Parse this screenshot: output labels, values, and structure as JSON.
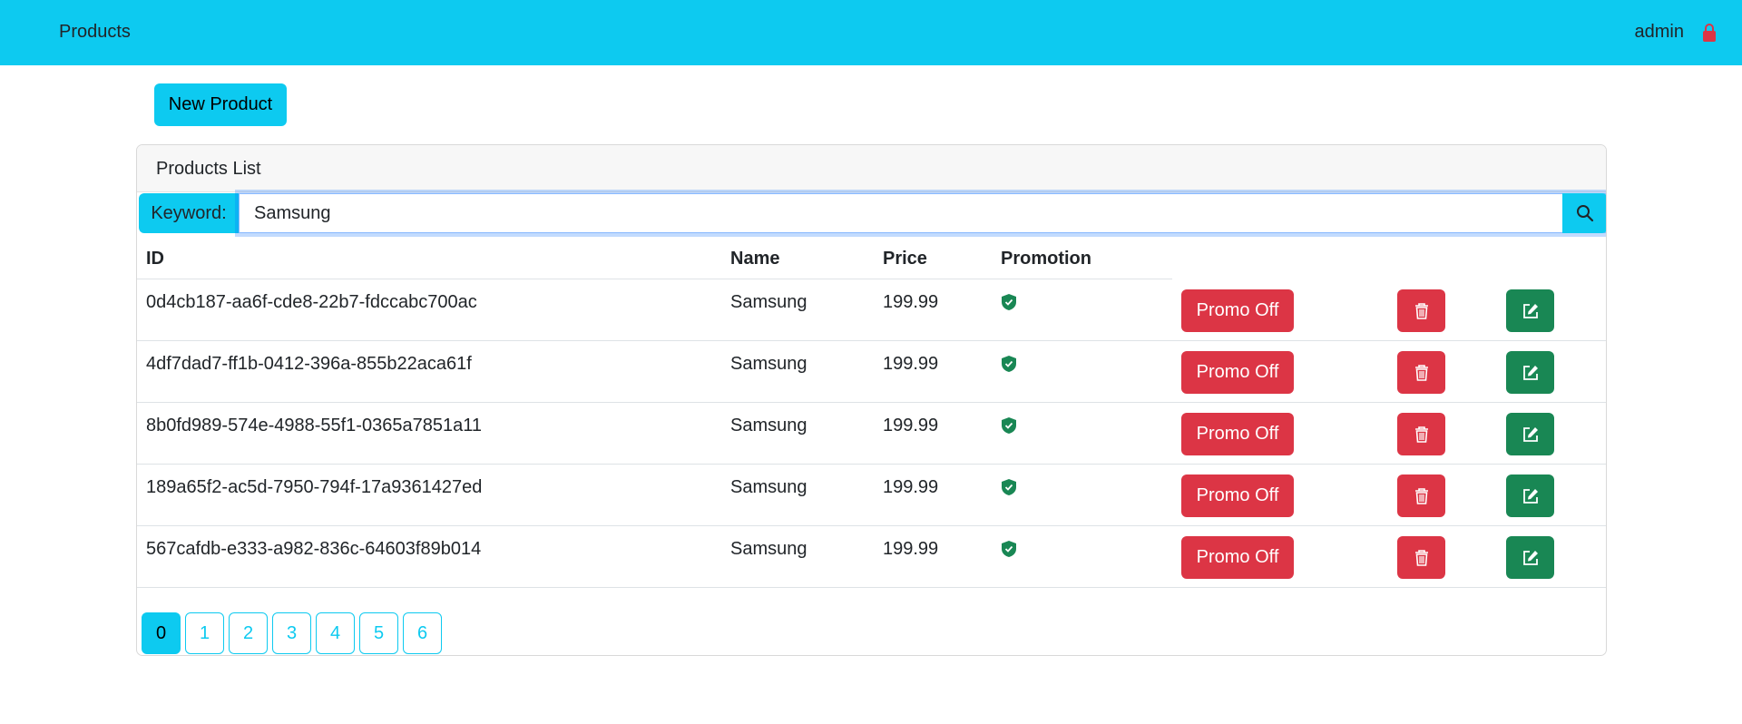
{
  "navbar": {
    "brand": "Products",
    "user": "admin",
    "logout_icon": "lock-icon",
    "background": "#0dcaf0"
  },
  "actions": {
    "new_product_label": "New Product"
  },
  "card": {
    "title": "Products List"
  },
  "search": {
    "label": "Keyword:",
    "value": "Samsung",
    "button_icon": "search-icon"
  },
  "table": {
    "headers": {
      "id": "ID",
      "name": "Name",
      "price": "Price",
      "promotion": "Promotion"
    },
    "rows": [
      {
        "id": "0d4cb187-aa6f-cde8-22b7-fdccabc700ac",
        "name": "Samsung",
        "price": "199.99",
        "promotion": true,
        "promo_button": "Promo Off"
      },
      {
        "id": "4df7dad7-ff1b-0412-396a-855b22aca61f",
        "name": "Samsung",
        "price": "199.99",
        "promotion": true,
        "promo_button": "Promo Off"
      },
      {
        "id": "8b0fd989-574e-4988-55f1-0365a7851a11",
        "name": "Samsung",
        "price": "199.99",
        "promotion": true,
        "promo_button": "Promo Off"
      },
      {
        "id": "189a65f2-ac5d-7950-794f-17a9361427ed",
        "name": "Samsung",
        "price": "199.99",
        "promotion": true,
        "promo_button": "Promo Off"
      },
      {
        "id": "567cafdb-e333-a982-836c-64603f89b014",
        "name": "Samsung",
        "price": "199.99",
        "promotion": true,
        "promo_button": "Promo Off"
      }
    ],
    "delete_icon": "trash-icon",
    "edit_icon": "edit-icon"
  },
  "pagination": {
    "pages": [
      "0",
      "1",
      "2",
      "3",
      "4",
      "5",
      "6"
    ],
    "current": "0"
  },
  "colors": {
    "info": "#0dcaf0",
    "danger": "#dc3545",
    "success": "#198754"
  }
}
